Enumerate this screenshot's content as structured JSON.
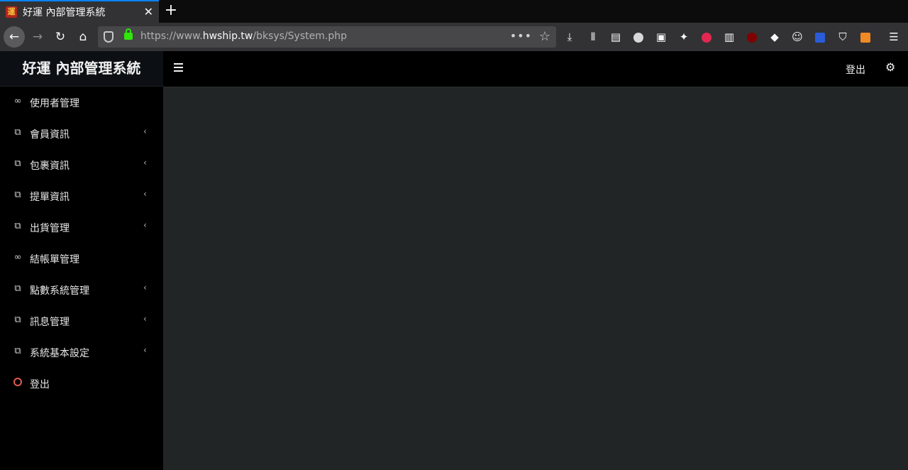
{
  "browser": {
    "tab_title": "好運 內部管理系統",
    "tab_close": "✕",
    "new_tab": "+",
    "url_prefix": "https://www.",
    "url_host": "hwship.tw",
    "url_path": "/bksys/System.php",
    "url_more": "•••",
    "favicon_glyph": "運"
  },
  "app": {
    "brand": "好運 內部管理系統",
    "menu": [
      {
        "label": "使用者管理",
        "icon": "link-icon",
        "has_submenu": false
      },
      {
        "label": "會員資訊",
        "icon": "copy-icon",
        "has_submenu": true
      },
      {
        "label": "包裹資訊",
        "icon": "copy-icon",
        "has_submenu": true
      },
      {
        "label": "提單資訊",
        "icon": "copy-icon",
        "has_submenu": true
      },
      {
        "label": "出貨管理",
        "icon": "copy-icon",
        "has_submenu": true
      },
      {
        "label": "結帳單管理",
        "icon": "link-icon",
        "has_submenu": false
      },
      {
        "label": "點數系統管理",
        "icon": "copy-icon",
        "has_submenu": true
      },
      {
        "label": "訊息管理",
        "icon": "copy-icon",
        "has_submenu": true
      },
      {
        "label": "系統基本設定",
        "icon": "copy-icon",
        "has_submenu": true
      },
      {
        "label": "登出",
        "icon": "circle-icon",
        "has_submenu": false
      }
    ],
    "topbar": {
      "logout": "登出"
    }
  },
  "colors": {
    "accent_tab": "#0a84ff",
    "logout_ring": "#e35a4f",
    "content_bg": "#212526"
  }
}
